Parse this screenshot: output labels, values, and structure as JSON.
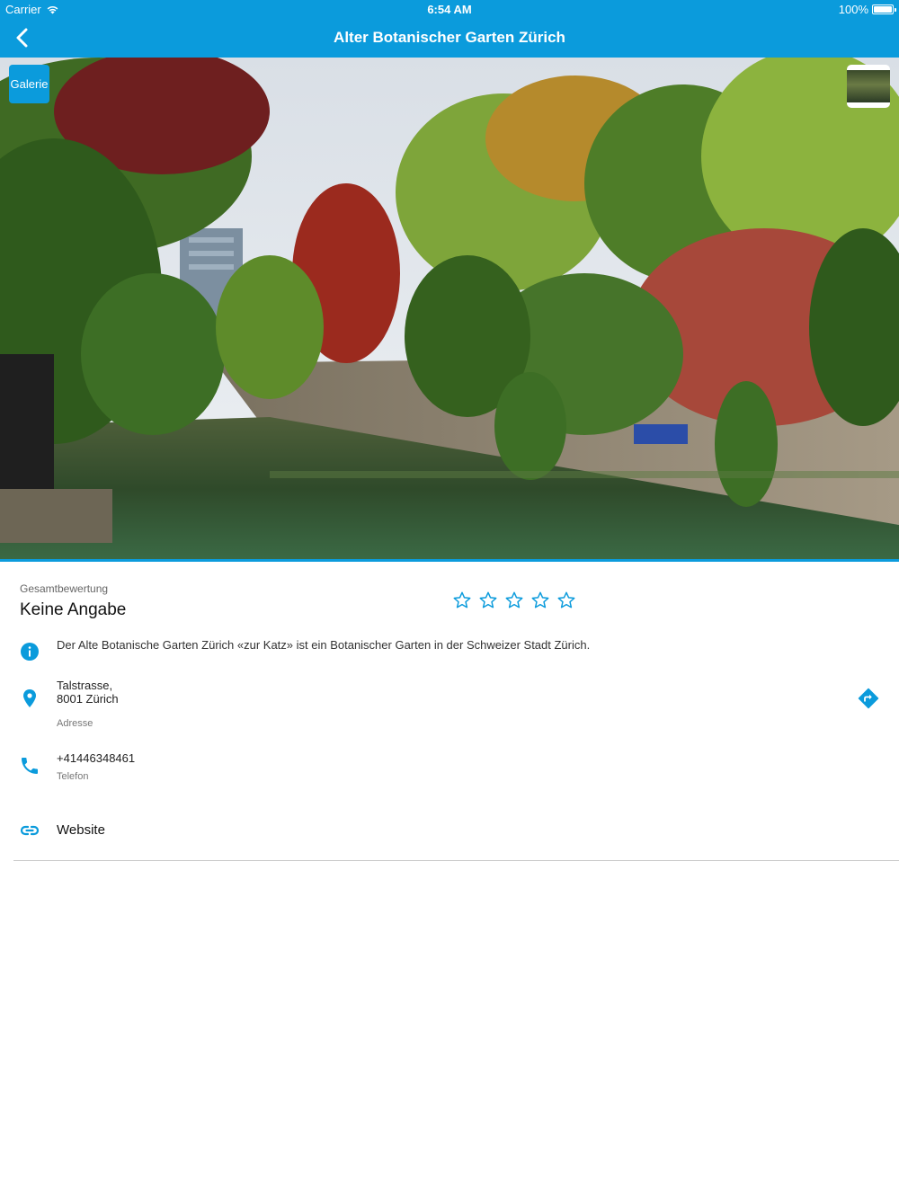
{
  "status_bar": {
    "carrier": "Carrier",
    "time": "6:54 AM",
    "battery": "100%"
  },
  "nav": {
    "title": "Alter Botanischer Garten Zürich"
  },
  "hero": {
    "gallery_label": "Galerie"
  },
  "rating": {
    "label": "Gesamtbewertung",
    "value": "Keine Angabe",
    "stars_max": 5,
    "stars_filled": 0
  },
  "info": {
    "description": "Der Alte Botanische Garten Zürich «zur Katz» ist ein Botanischer Garten in der Schweizer Stadt Zürich."
  },
  "address": {
    "line1": "Talstrasse,",
    "line2": "8001 Zürich",
    "label": "Adresse"
  },
  "phone": {
    "number": "+41446348461",
    "label": "Telefon"
  },
  "website": {
    "label": "Website"
  },
  "colors": {
    "accent": "#0b9bdc"
  }
}
